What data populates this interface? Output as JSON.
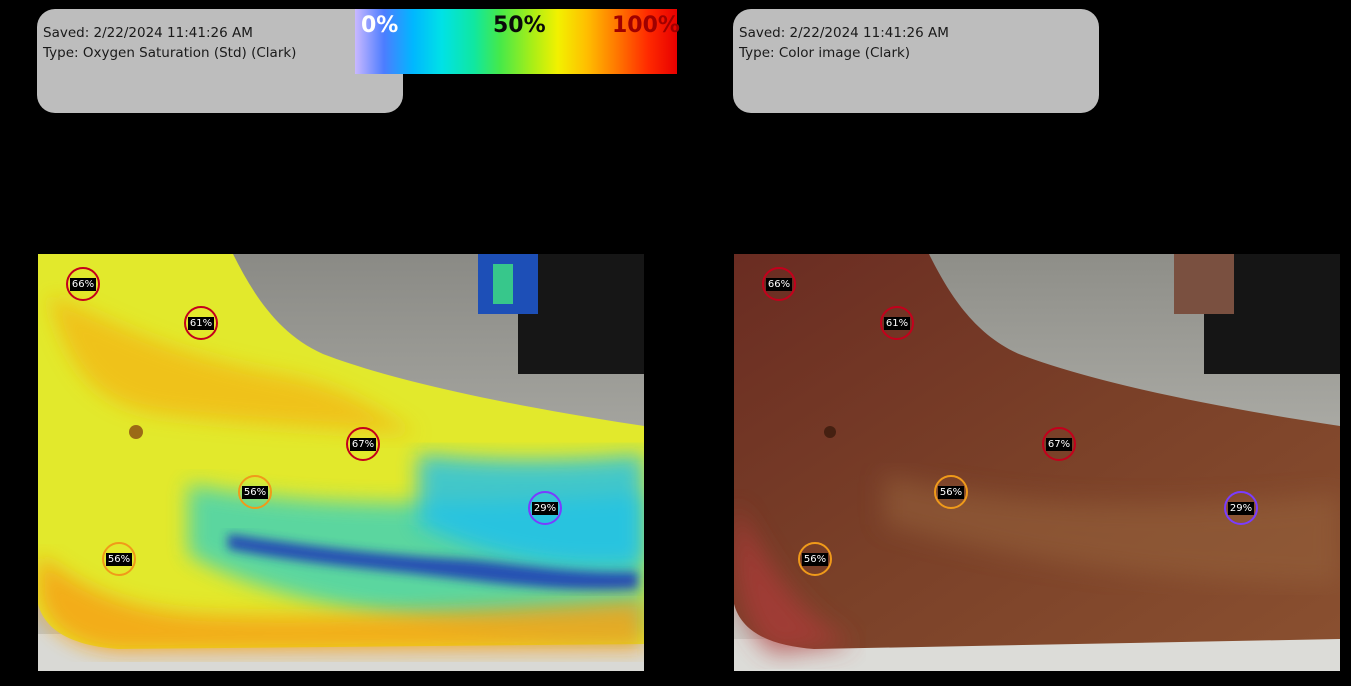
{
  "left_panel": {
    "saved": "Saved: 2/22/2024 11:41:26 AM",
    "type": "Type: Oxygen Saturation (Std) (Clark)"
  },
  "right_panel": {
    "saved": "Saved: 2/22/2024 11:41:26 AM",
    "type": "Type: Color image (Clark)"
  },
  "colorbar": {
    "low": "0%",
    "mid": "50%",
    "high": "100%"
  },
  "markers": [
    {
      "value": "66%",
      "color": "#c4001c"
    },
    {
      "value": "61%",
      "color": "#c4001c"
    },
    {
      "value": "67%",
      "color": "#c4001c"
    },
    {
      "value": "56%",
      "color": "#f09a1a"
    },
    {
      "value": "56%",
      "color": "#f09a1a"
    },
    {
      "value": "29%",
      "color": "#7a3cff"
    }
  ],
  "colors": {
    "background": "#000000",
    "info_box": "#bdbdbd"
  }
}
